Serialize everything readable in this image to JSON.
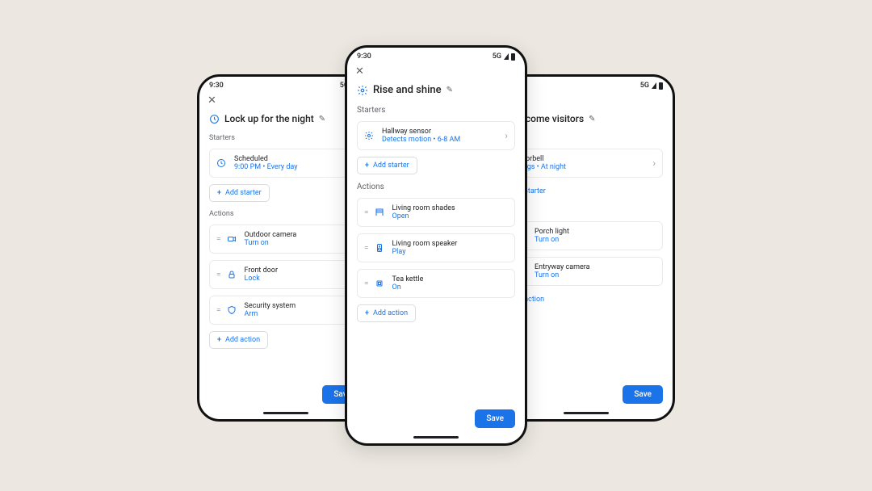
{
  "statusBar": {
    "time": "9:30",
    "network": "5G"
  },
  "common": {
    "startersLabel": "Starters",
    "actionsLabel": "Actions",
    "addStarter": "Add starter",
    "addAction": "Add action",
    "save": "Save"
  },
  "left": {
    "title": "Lock up for the night",
    "starters": [
      {
        "icon": "clock",
        "line1": "Scheduled",
        "line2": "9:00 PM • Every day"
      }
    ],
    "actions": [
      {
        "icon": "camera",
        "line1": "Outdoor camera",
        "line2": "Turn on"
      },
      {
        "icon": "lock",
        "line1": "Front door",
        "line2": "Lock"
      },
      {
        "icon": "shield",
        "line1": "Security system",
        "line2": "Arm"
      }
    ]
  },
  "center": {
    "title": "Rise and shine",
    "starters": [
      {
        "icon": "gear",
        "line1": "Hallway sensor",
        "line2": "Detects motion • 6-8 AM"
      }
    ],
    "actions": [
      {
        "icon": "shades",
        "line1": "Living room shades",
        "line2": "Open"
      },
      {
        "icon": "speaker",
        "line1": "Living room speaker",
        "line2": "Play"
      },
      {
        "icon": "kettle",
        "line1": "Tea kettle",
        "line2": "On"
      }
    ]
  },
  "right": {
    "title": "Welcome visitors",
    "starters": [
      {
        "icon": "doorbell",
        "line1": "Doorbell",
        "line2": "Rings • At night"
      }
    ],
    "actions": [
      {
        "icon": "bulb",
        "line1": "Porch light",
        "line2": "Turn on"
      },
      {
        "icon": "camera",
        "line1": "Entryway camera",
        "line2": "Turn on"
      }
    ]
  }
}
